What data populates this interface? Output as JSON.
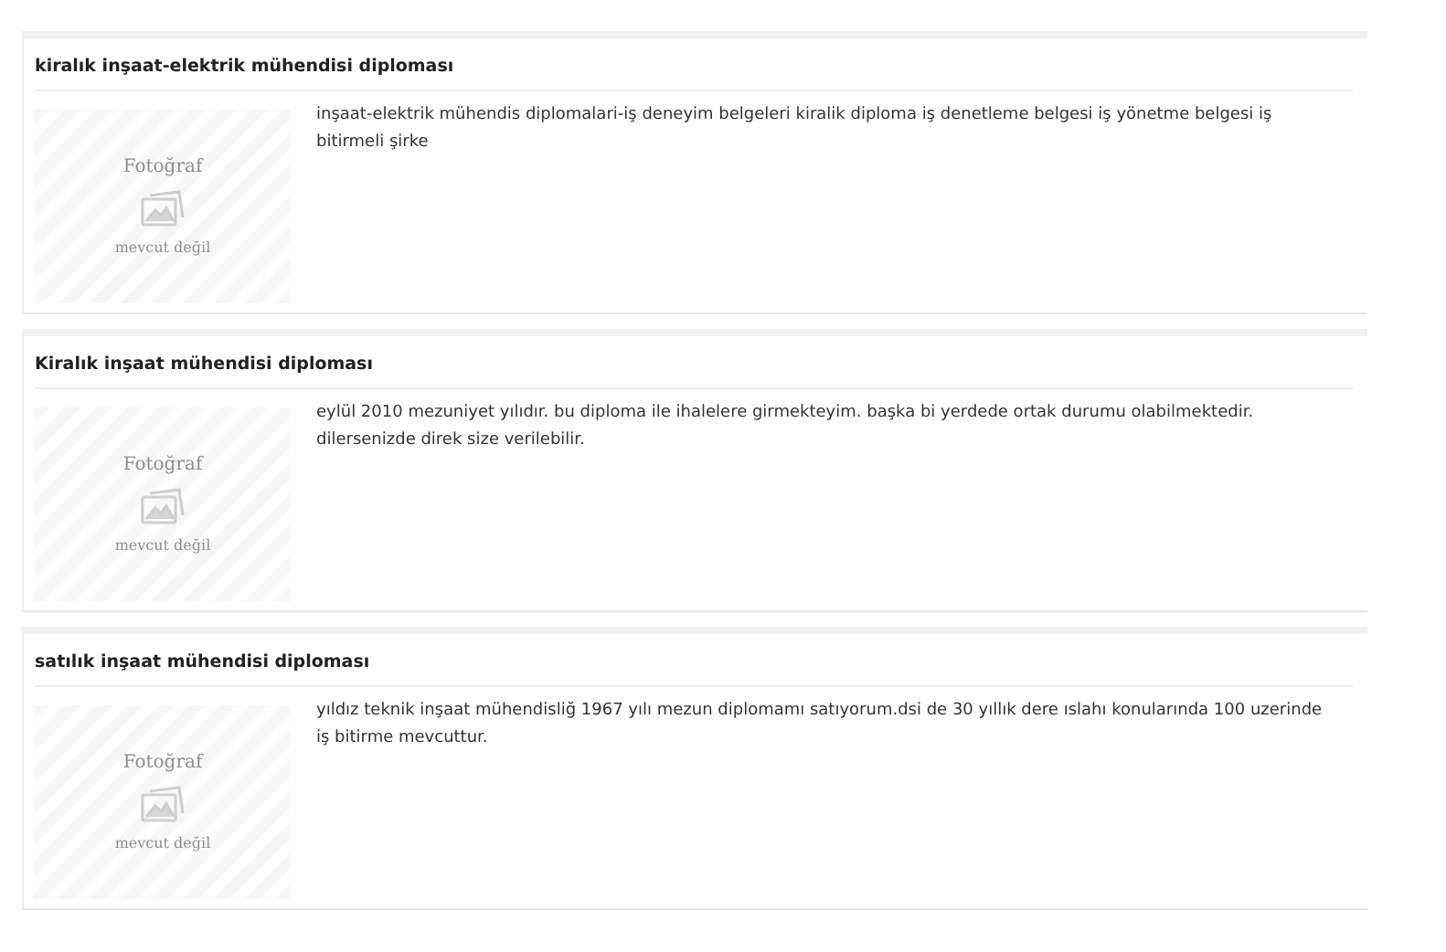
{
  "listings": [
    {
      "title": "kiralık inşaat-elektrik mühendisi diploması",
      "photo": {
        "label": "Fotoğraf",
        "caption": "mevcut değil"
      },
      "description": "inşaat-elektrik mühendis diplomalari-iş deneyim belgeleri kiralik diploma iş denetleme belgesi iş yönetme belgesi iş bitirmeli şirke"
    },
    {
      "title": "Kiralık inşaat mühendisi diploması",
      "photo": {
        "label": "Fotoğraf",
        "caption": "mevcut değil"
      },
      "description": "eylül 2010 mezuniyet yılıdır. bu diploma ile ihalelere girmekteyim. başka bi yerdede ortak durumu olabilmektedir. dilersenizde direk size verilebilir."
    },
    {
      "title": "satılık inşaat mühendisi diploması",
      "photo": {
        "label": "Fotoğraf",
        "caption": "mevcut değil"
      },
      "description": "yıldız teknik inşaat mühendisliğ 1967 yılı mezun diplomamı satıyorum.dsi de 30 yıllık dere ıslahı konularında 100 uzerinde iş bitirme mevcuttur."
    }
  ]
}
